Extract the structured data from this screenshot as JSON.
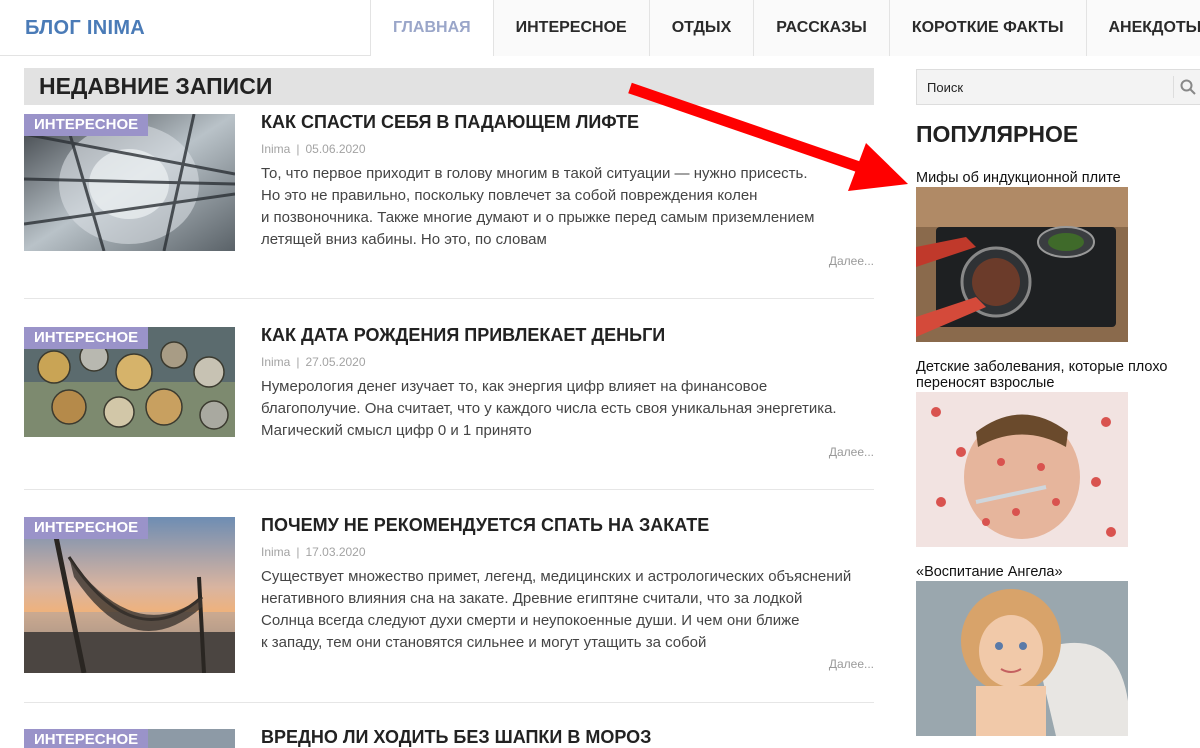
{
  "header": {
    "logo": "БЛОГ INIMA",
    "nav": [
      {
        "label": "ГЛАВНАЯ",
        "active": true
      },
      {
        "label": "ИНТЕРЕСНОЕ",
        "active": false
      },
      {
        "label": "ОТДЫХ",
        "active": false
      },
      {
        "label": "РАССКАЗЫ",
        "active": false
      },
      {
        "label": "КОРОТКИЕ ФАКТЫ",
        "active": false
      },
      {
        "label": "АНЕКДОТЫ",
        "active": false
      }
    ]
  },
  "main": {
    "section_title": "НЕДАВНИЕ ЗАПИСИ",
    "posts": [
      {
        "category": "ИНТЕРЕСНОЕ",
        "title": "КАК СПАСТИ СЕБЯ В ПАДАЮЩЕМ ЛИФТЕ",
        "author": "Inima",
        "date": "05.06.2020",
        "excerpt_lines": [
          "То, что первое приходит в голову многим в такой ситуации — нужно присесть.",
          "Но это не правильно, поскольку повлечет за собой повреждения колен",
          "и позвоночника. Также многие думают и о прыжке перед самым приземлением",
          "летящей вниз кабины. Но это, по словам"
        ],
        "more": "Далее...",
        "image": "elevator-shaft-image"
      },
      {
        "category": "ИНТЕРЕСНОЕ",
        "title": "КАК ДАТА РОЖДЕНИЯ ПРИВЛЕКАЕТ ДЕНЬГИ",
        "author": "Inima",
        "date": "27.05.2020",
        "excerpt_lines": [
          "Нумерология денег изучает то, как энергия цифр влияет на финансовое",
          "благополучие. Она считает, что у каждого числа есть своя уникальная энергетика.",
          "Магический смысл цифр 0 и 1 принято"
        ],
        "more": "Далее...",
        "image": "coins-image"
      },
      {
        "category": "ИНТЕРЕСНОЕ",
        "title": "ПОЧЕМУ НЕ РЕКОМЕНДУЕТСЯ СПАТЬ НА ЗАКАТЕ",
        "author": "Inima",
        "date": "17.03.2020",
        "excerpt_lines": [
          "Существует множество примет, легенд, медицинских и астрологических объяснений",
          "негативного влияния сна на закате. Древние египтяне считали, что за лодкой",
          "Солнца всегда следуют духи смерти и неупокоенные души. И чем они ближе",
          "к западу, тем они становятся сильнее и могут утащить за собой"
        ],
        "more": "Далее...",
        "image": "hammock-sunset-image"
      },
      {
        "category": "ИНТЕРЕСНОЕ",
        "title": "ВРЕДНО ЛИ ХОДИТЬ БЕЗ ШАПКИ В МОРОЗ",
        "author": "",
        "date": "",
        "excerpt_lines": [],
        "more": "",
        "image": "winter-image"
      }
    ]
  },
  "sidebar": {
    "search_placeholder": "Поиск",
    "popular_title": "ПОПУЛЯРНОЕ",
    "popular": [
      {
        "title": "Мифы об индукционной плите",
        "image": "induction-cooktop-image"
      },
      {
        "title": "Детские заболевания, которые плохо переносят взрослые",
        "image": "sick-man-image"
      },
      {
        "title": "«Воспитание Ангела»",
        "image": "angel-child-image"
      }
    ]
  },
  "colors": {
    "logo": "#4a7bb7",
    "nav_active": "#9aa6c9",
    "category_badge": "#9a93c9",
    "section_bg": "#e2e2e2",
    "arrow": "#ff0000"
  }
}
